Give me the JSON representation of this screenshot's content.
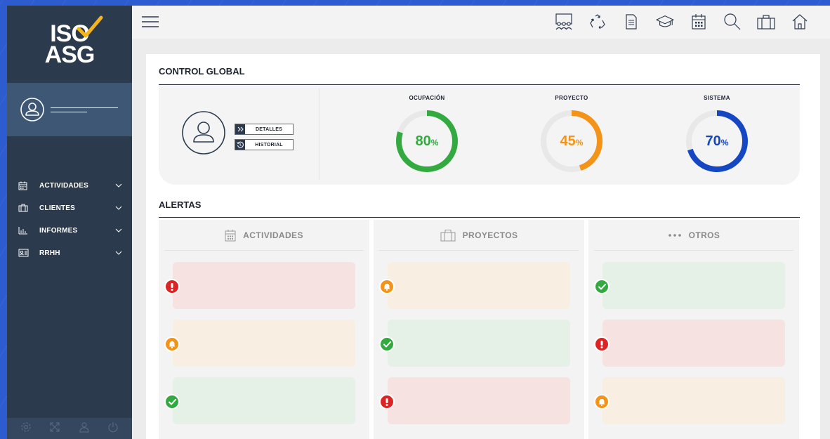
{
  "logo": {
    "line1": "ISO",
    "line2": "ASG"
  },
  "colors": {
    "red": "#dd2424",
    "orange": "#f39318",
    "green": "#33aa3f",
    "blue": "#1547c3",
    "red_bg": "#f7e2e2",
    "orange_bg": "#f8efe2",
    "green_bg": "#e5f1e6"
  },
  "sidebar": {
    "items": [
      {
        "icon": "calendar-icon",
        "label": "ACTIVIDADES"
      },
      {
        "icon": "briefcase-icon",
        "label": "CLIENTES"
      },
      {
        "icon": "bar-chart-icon",
        "label": "INFORMES"
      },
      {
        "icon": "id-card-icon",
        "label": "RRHH"
      }
    ],
    "footer_icons": [
      "gear-icon",
      "expand-icon",
      "user-icon",
      "power-icon"
    ]
  },
  "topbar": {
    "icons": [
      "team-icon",
      "recycle-icon",
      "document-icon",
      "graduation-cap-icon",
      "calendar-icon",
      "search-icon",
      "briefcase-icon",
      "home-icon"
    ]
  },
  "control_global": {
    "title": "CONTROL GLOBAL",
    "buttons": {
      "details": "DETALLES",
      "history": "HISTORIAL"
    },
    "gauges": [
      {
        "label": "OCUPACIÓN",
        "value": "80",
        "unit": "%",
        "percent": 80,
        "color": "#33aa3f"
      },
      {
        "label": "PROYECTO",
        "value": "45",
        "unit": "%",
        "percent": 45,
        "color": "#f39318"
      },
      {
        "label": "SISTEMA",
        "value": "70",
        "unit": "%",
        "percent": 70,
        "color": "#1547c3"
      }
    ]
  },
  "alertas": {
    "title": "ALERTAS",
    "columns": [
      {
        "title": "ACTIVIDADES",
        "icon": "calendar-icon",
        "items": [
          "error",
          "warning",
          "ok"
        ]
      },
      {
        "title": "PROYECTOS",
        "icon": "briefcase-icon",
        "items": [
          "warning",
          "ok",
          "error"
        ]
      },
      {
        "title": "OTROS",
        "icon": "more-dots-icon",
        "items": [
          "ok",
          "error",
          "warning"
        ]
      }
    ]
  }
}
